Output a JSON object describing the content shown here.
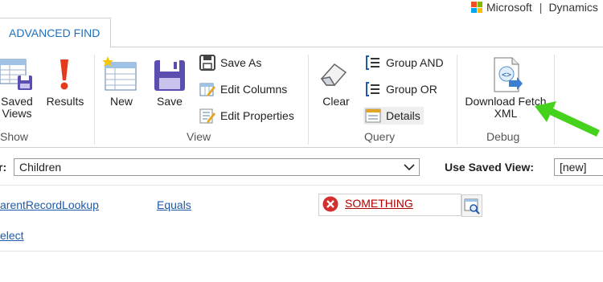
{
  "header": {
    "brand_microsoft": "Microsoft",
    "brand_sep": "|",
    "brand_product": "Dynamics"
  },
  "tab": {
    "label": "ADVANCED FIND"
  },
  "ribbon": {
    "show": {
      "saved_views_line1": "Saved",
      "saved_views_line2": "Views",
      "results": "Results",
      "group_label": "Show"
    },
    "view": {
      "new": "New",
      "save": "Save",
      "save_as": "Save As",
      "edit_columns": "Edit Columns",
      "edit_properties": "Edit Properties",
      "group_label": "View"
    },
    "query": {
      "clear": "Clear",
      "group_and": "Group AND",
      "group_or": "Group OR",
      "details": "Details",
      "group_label": "Query"
    },
    "debug": {
      "download_line1": "Download Fetch",
      "download_line2": "XML",
      "group_label": "Debug"
    }
  },
  "filter": {
    "look_for_label": "r:",
    "look_for_value": "Children",
    "saved_view_label": "Use Saved View:",
    "saved_view_value": "[new]"
  },
  "criteria": {
    "field": "arentRecordLookup",
    "operator": "Equals",
    "value": "SOMETHING",
    "select_link": "elect"
  },
  "colors": {
    "accent": "#1f6fbf",
    "arrow": "#44d21c",
    "error": "#d32f2f"
  }
}
